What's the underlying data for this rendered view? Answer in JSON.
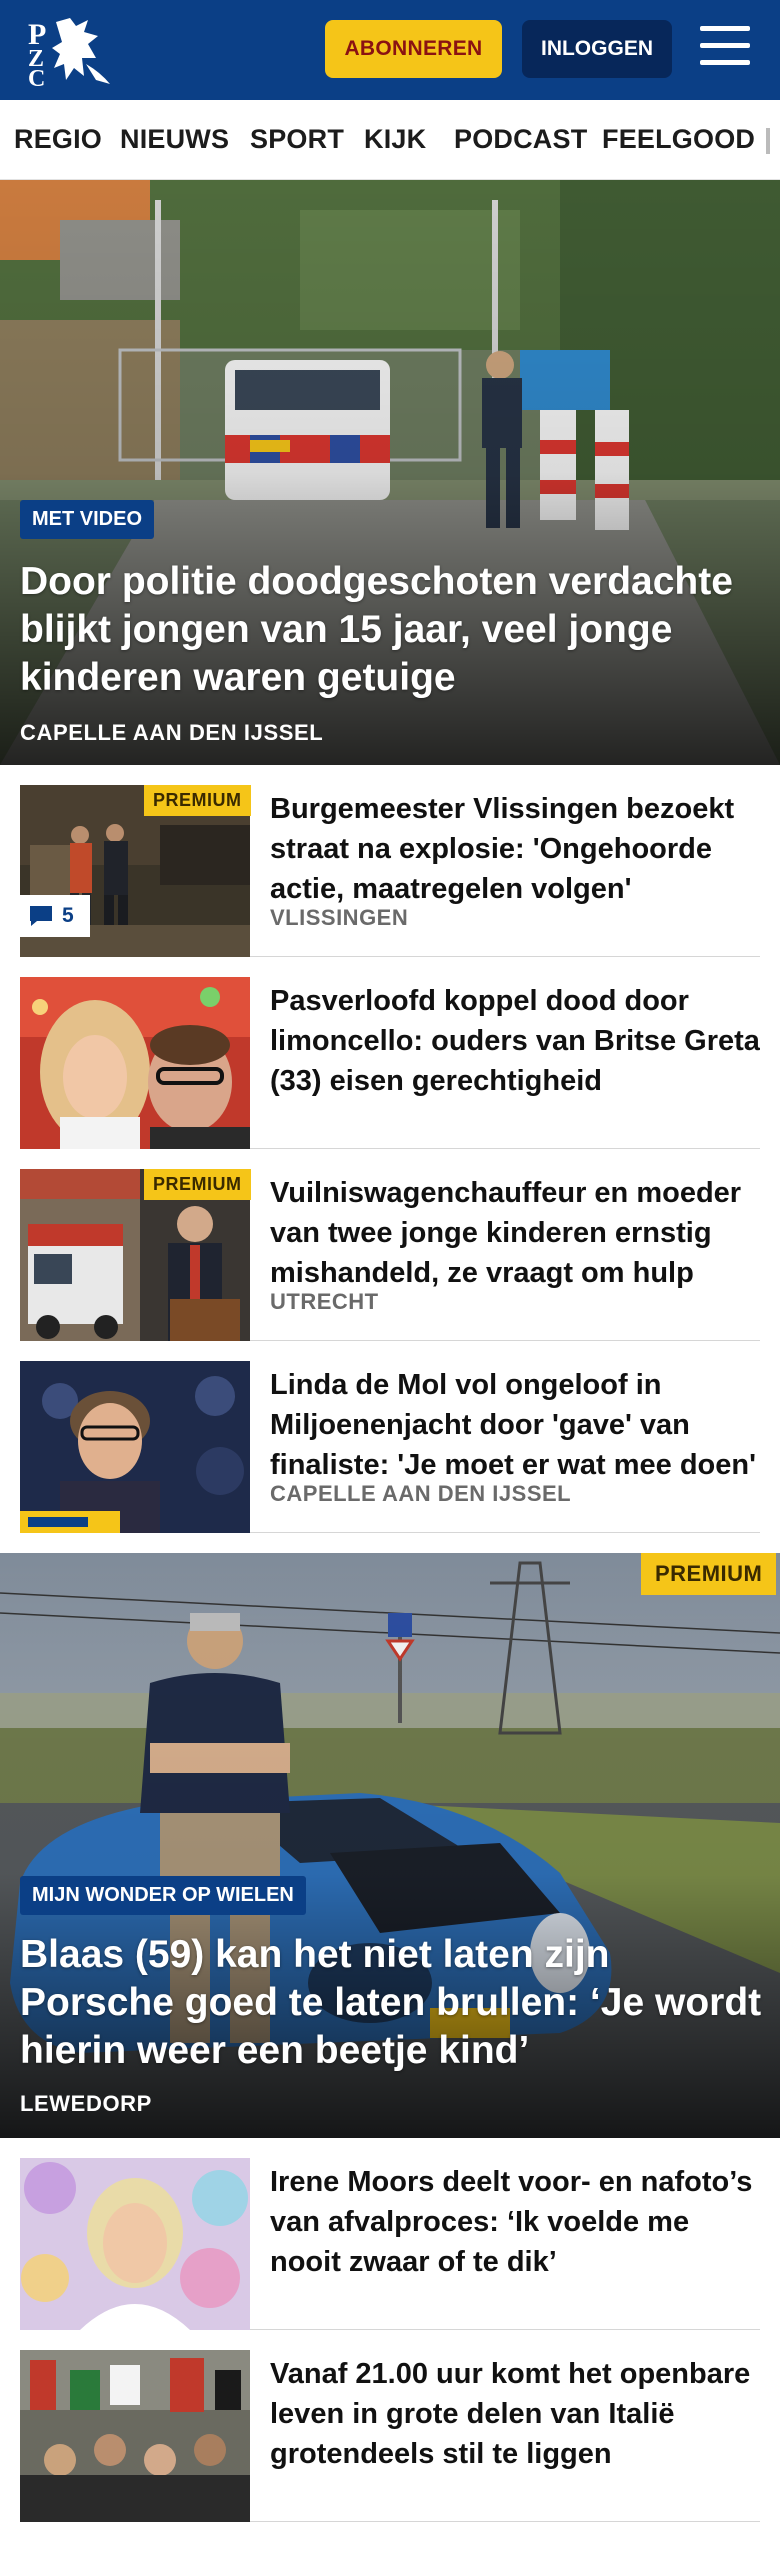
{
  "header": {
    "logo_text": "PZC",
    "subscribe_label": "ABONNEREN",
    "login_label": "INLOGGEN",
    "menu_icon": "hamburger-menu-icon",
    "brand_color": "#0b3f86",
    "accent_color": "#f5c518"
  },
  "nav": {
    "items": [
      "REGIO",
      "NIEUWS",
      "SPORT",
      "KIJK",
      "PODCAST",
      "FEELGOOD"
    ]
  },
  "hero1": {
    "badge": "MET VIDEO",
    "title": "Door politie doodgeschoten verdachte blijkt jongen van 15 jaar, veel jonge kinderen waren getuige",
    "location": "CAPELLE AAN DEN IJSSEL"
  },
  "articles": [
    {
      "premium": "PREMIUM",
      "title": "Burgemeester Vlissingen bezoekt straat na explosie: 'Ongehoorde actie, maatregelen volgen'",
      "location": "VLISSINGEN",
      "comments": "5"
    },
    {
      "title": "Pasverloofd koppel dood door limoncello: ouders van Britse Greta (33) eisen gerechtigheid"
    },
    {
      "premium": "PREMIUM",
      "title": "Vuilniswagenchauffeur en moeder van twee jonge kinderen ernstig mishandeld, ze vraagt om hulp",
      "location": "UTRECHT"
    },
    {
      "title": "Linda de Mol vol ongeloof in Miljoenenjacht door 'gave' van finaliste: 'Je moet er wat mee doen'",
      "location": "CAPELLE AAN DEN IJSSEL"
    }
  ],
  "hero2": {
    "premium": "PREMIUM",
    "badge": "MIJN WONDER OP WIELEN",
    "title": "Blaas (59) kan het niet laten zijn Porsche goed te laten brullen: ‘Je wordt hierin weer een beetje kind’",
    "location": "LEWEDORP"
  },
  "articles2": [
    {
      "title": "Irene Moors deelt voor- en nafoto’s van afvalproces: ‘Ik voelde me nooit zwaar of te dik’"
    },
    {
      "title": "Vanaf 21.00 uur komt het openbare leven in grote delen van Italië grotendeels stil te liggen"
    }
  ]
}
